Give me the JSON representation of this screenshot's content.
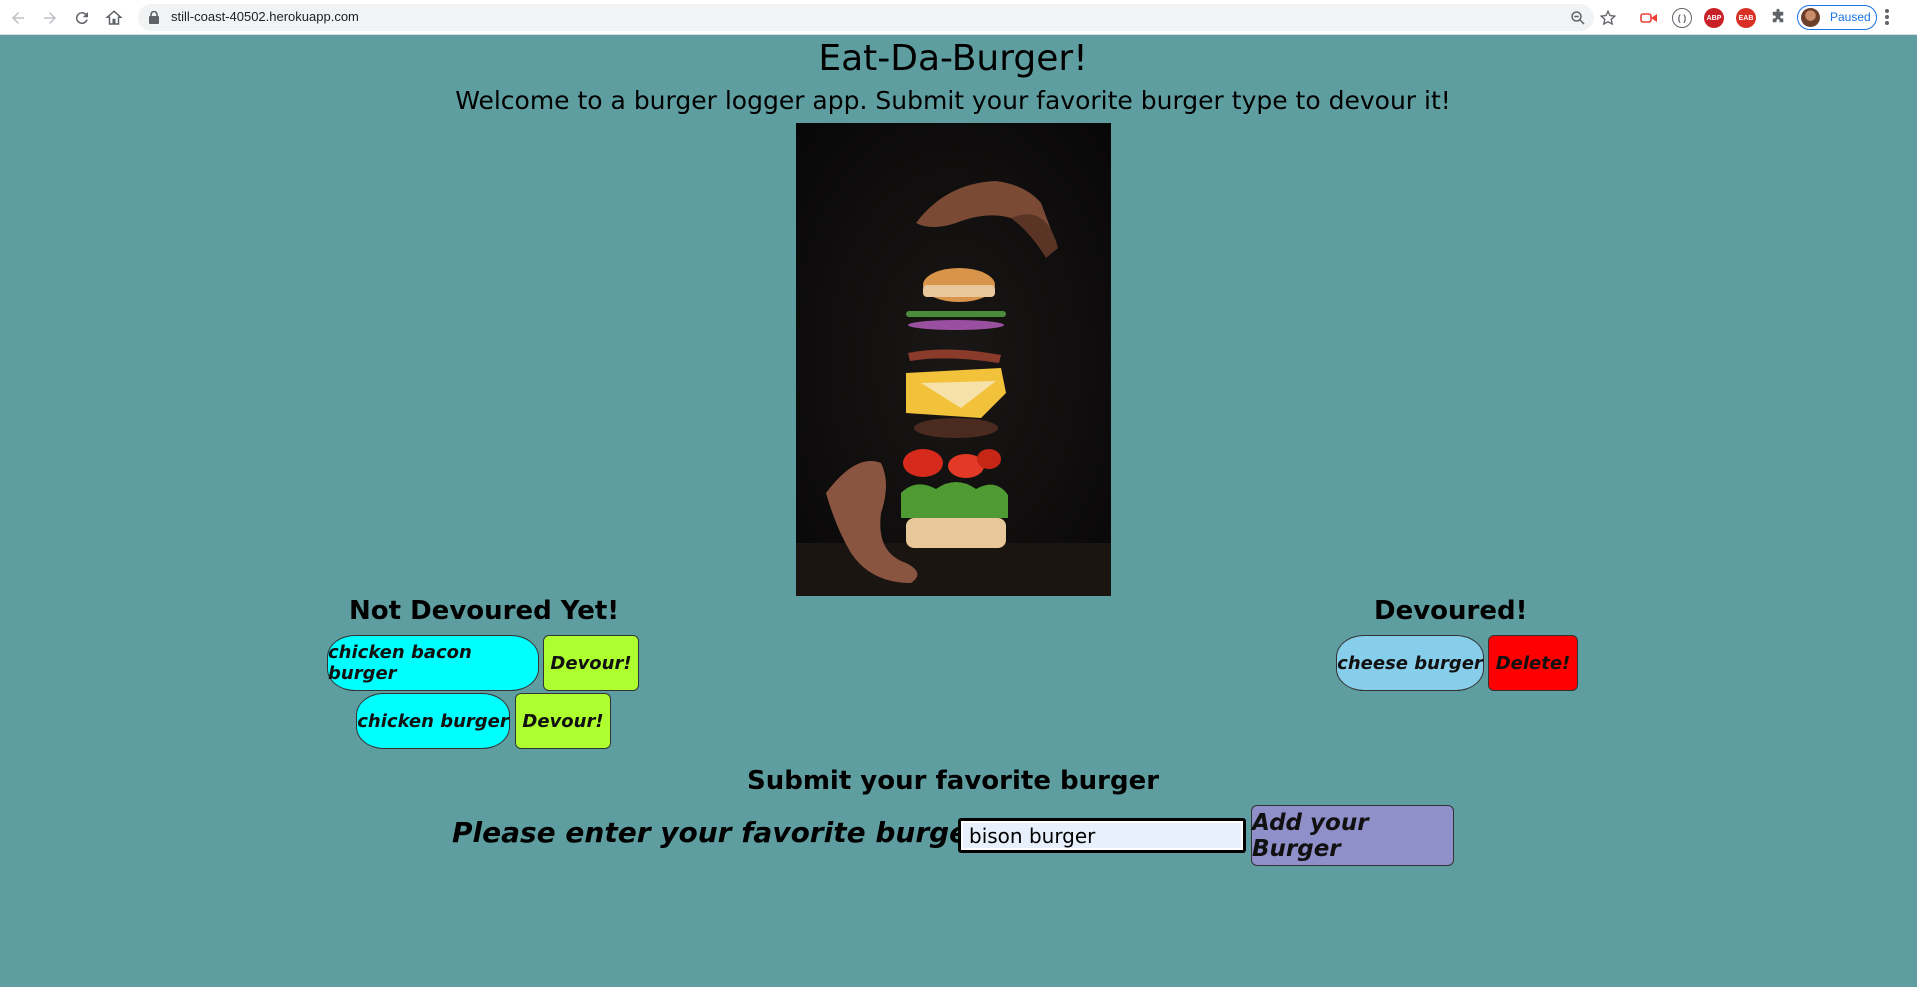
{
  "browser": {
    "url": "still-coast-40502.herokuapp.com",
    "profile_status": "Paused",
    "extensions": [
      "ABP",
      "EAB"
    ]
  },
  "page": {
    "title": "Eat-Da-Burger!",
    "welcome": "Welcome to a burger logger app. Submit your favorite burger type to devour it!"
  },
  "not_devoured": {
    "heading": "Not Devoured Yet!",
    "burgers": [
      {
        "name": "chicken bacon burger",
        "action": "Devour!"
      },
      {
        "name": "chicken burger",
        "action": "Devour!"
      }
    ]
  },
  "devoured": {
    "heading": "Devoured!",
    "burgers": [
      {
        "name": "cheese burger",
        "action": "Delete!"
      }
    ]
  },
  "form": {
    "heading": "Submit your favorite burger",
    "label": "Please enter your favorite burger name:",
    "input_value": "bison burger",
    "submit_label": "Add your Burger"
  },
  "colors": {
    "background": "#5f9ea0",
    "pill_not_devoured": "#00ffff",
    "pill_devoured": "#87ceeb",
    "devour_button": "#adff2f",
    "delete_button": "#ff0000",
    "add_button": "#8f8fc9"
  }
}
